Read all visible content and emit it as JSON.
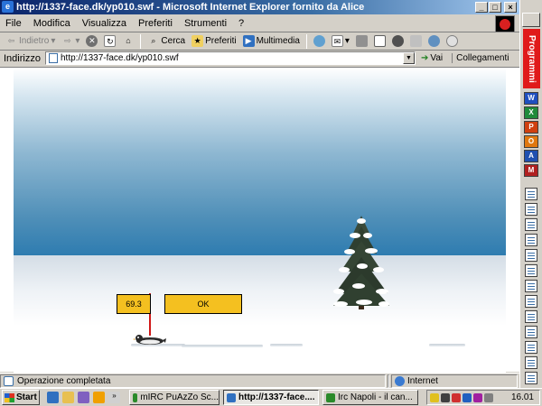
{
  "window": {
    "title": "http://1337-face.dk/yp010.swf - Microsoft Internet Explorer fornito da Alice"
  },
  "menu": [
    "File",
    "Modifica",
    "Visualizza",
    "Preferiti",
    "Strumenti",
    "?"
  ],
  "toolbar": {
    "back": "Indietro",
    "search": "Cerca",
    "favorites": "Preferiti",
    "media": "Multimedia"
  },
  "address": {
    "label": "Indirizzo",
    "url": "http://1337-face.dk/yp010.swf",
    "go": "Vai",
    "links": "Collegamenti"
  },
  "game": {
    "distance": "69.3",
    "ok_label": "OK"
  },
  "status": {
    "text": "Operazione completata",
    "zone": "Internet"
  },
  "sidebar": {
    "title": "Programmi",
    "apps": [
      {
        "letter": "W",
        "color": "#1f4fbf"
      },
      {
        "letter": "X",
        "color": "#1f8a3a"
      },
      {
        "letter": "P",
        "color": "#d04010"
      },
      {
        "letter": "O",
        "color": "#e07810"
      },
      {
        "letter": "A",
        "color": "#2050b0"
      },
      {
        "letter": "M",
        "color": "#b02020"
      }
    ],
    "doc_count": 13
  },
  "taskbar": {
    "start": "Start",
    "tasks": [
      "mIRC PuAzZo Sc...",
      "http://1337-face....",
      "Irc Napoli - il can..."
    ],
    "active_task": 1,
    "clock": "16.01"
  }
}
